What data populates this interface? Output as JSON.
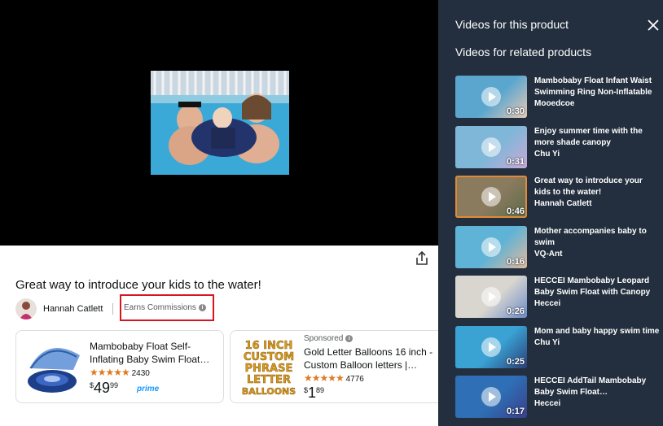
{
  "video": {
    "title": "Great way to introduce your kids to the water!",
    "creator": "Hannah Catlett",
    "earns_label": "Earns Commissions"
  },
  "products": [
    {
      "title": "Mambobaby Float Self-Inflating Baby Swim Float…",
      "rating_stars": 4.5,
      "rating_count": "2430",
      "price_symbol": "$",
      "price_whole": "49",
      "price_cents": "99",
      "prime_label": "prime",
      "sponsored": ""
    },
    {
      "title": "Gold Letter Balloons 16 inch - Custom Balloon letters |…",
      "rating_stars": 4.5,
      "rating_count": "4776",
      "price_symbol": "$",
      "price_whole": "1",
      "price_cents": "89",
      "sponsored": "Sponsored",
      "image_text": [
        "16 INCH",
        "CUSTOM",
        "PHRASE",
        "LETTER",
        "BALLOONS"
      ]
    }
  ],
  "panel": {
    "heading": "Videos for this product",
    "related_heading": "Videos for related products",
    "videos": [
      {
        "title": "Mambobaby Float Infant Waist Swimming Ring Non-Inflatable",
        "creator": "Mooedcoe",
        "duration": "0:30",
        "active": false
      },
      {
        "title": "Enjoy summer time with the more shade canopy",
        "creator": "Chu Yi",
        "duration": "0:31",
        "active": false
      },
      {
        "title": "Great way to introduce your kids to the water!",
        "creator": "Hannah Catlett",
        "duration": "0:46",
        "active": true
      },
      {
        "title": "Mother accompanies baby to swim",
        "creator": "VQ-Ant",
        "duration": "0:16",
        "active": false
      },
      {
        "title": "HECCEI Mambobaby Leopard Baby Swim Float with Canopy",
        "creator": "Heccei",
        "duration": "0:26",
        "active": false
      },
      {
        "title": "Mom and baby happy swim time",
        "creator": "Chu Yi",
        "duration": "0:25",
        "active": false
      },
      {
        "title": "HECCEI AddTail Mambobaby Baby Swim Float…",
        "creator": "Heccei",
        "duration": "0:17",
        "active": false
      }
    ]
  },
  "icons": {
    "share": "share-icon",
    "close": "close-icon",
    "info": "info-icon",
    "play": "play-icon"
  },
  "colors": {
    "panel_bg": "#232f3e",
    "highlight_box": "#d8141e",
    "active_thumb_border": "#e08a35",
    "star": "#de7921",
    "prime": "#1399ff"
  }
}
